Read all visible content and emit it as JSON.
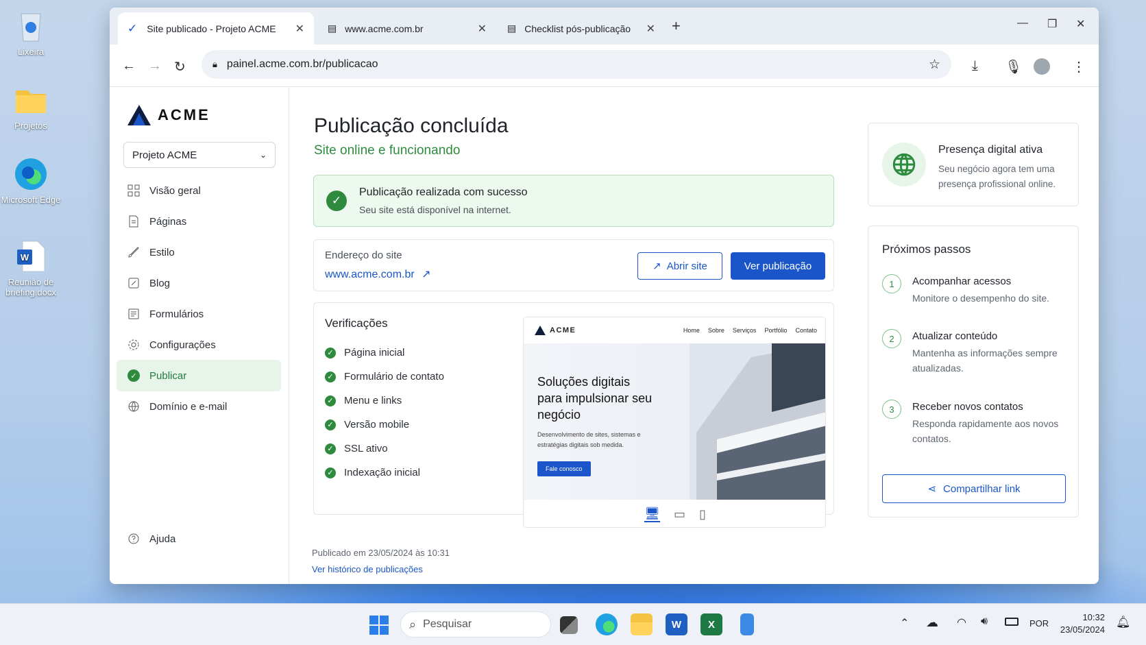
{
  "desktop": {
    "icons": [
      {
        "label": "Lixeira"
      },
      {
        "label": "Projetos"
      },
      {
        "label": "Microsoft Edge"
      },
      {
        "label": "Reunião de briefing.docx"
      }
    ]
  },
  "browser": {
    "tabs": [
      {
        "title": "Site publicado - Projeto ACME"
      },
      {
        "title": "www.acme.com.br"
      },
      {
        "title": "Checklist pós-publicação"
      }
    ],
    "url": "painel.acme.com.br/publicacao"
  },
  "sidebar": {
    "logo": "ACME",
    "project": "Projeto ACME",
    "items": [
      {
        "label": "Visão geral"
      },
      {
        "label": "Páginas"
      },
      {
        "label": "Estilo"
      },
      {
        "label": "Blog"
      },
      {
        "label": "Formulários"
      },
      {
        "label": "Configurações"
      },
      {
        "label": "Publicar"
      },
      {
        "label": "Domínio e e-mail"
      }
    ],
    "help": "Ajuda"
  },
  "main": {
    "title": "Publicação concluída",
    "subtitle": "Site online e funcionando",
    "success": {
      "title": "Publicação realizada com sucesso",
      "desc": "Seu site está disponível na internet."
    },
    "address": {
      "label": "Endereço do site",
      "url": "www.acme.com.br",
      "open_btn": "Abrir site",
      "view_btn": "Ver publicação"
    },
    "checks": {
      "title": "Verificações",
      "items": [
        "Página inicial",
        "Formulário de contato",
        "Menu e links",
        "Versão mobile",
        "SSL ativo",
        "Indexação inicial"
      ]
    },
    "preview": {
      "brand": "ACME",
      "nav": [
        "Home",
        "Sobre",
        "Serviços",
        "Portfólio",
        "Contato"
      ],
      "headline": "Soluções digitais para impulsionar seu negócio",
      "desc": "Desenvolvimento de sites, sistemas e estratégias digitais sob medida.",
      "cta": "Fale conosco"
    },
    "published_at": "Publicado em 23/05/2024 às 10:31",
    "history_link": "Ver histórico de publicações"
  },
  "right": {
    "presence": {
      "title": "Presença digital ativa",
      "desc": "Seu negócio agora tem uma presença profissional online."
    },
    "next_title": "Próximos passos",
    "steps": [
      {
        "num": "1",
        "title": "Acompanhar acessos",
        "desc": "Monitore o desempenho do site."
      },
      {
        "num": "2",
        "title": "Atualizar conteúdo",
        "desc": "Mantenha as informações sempre atualizadas."
      },
      {
        "num": "3",
        "title": "Receber novos contatos",
        "desc": "Responda rapidamente aos novos contatos."
      }
    ],
    "share": "Compartilhar link"
  },
  "taskbar": {
    "search": "Pesquisar",
    "lang": "POR",
    "time": "10:32",
    "date": "23/05/2024"
  },
  "colors": {
    "green": "#2e8b3e",
    "blue": "#1a56c9"
  }
}
